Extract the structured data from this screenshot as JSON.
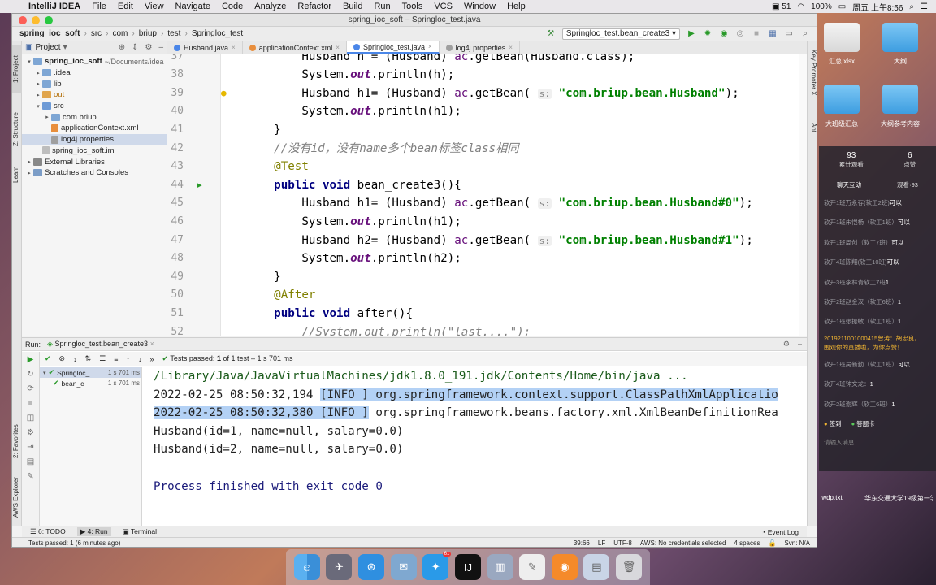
{
  "menubar": {
    "app": "IntelliJ IDEA",
    "items": [
      "File",
      "Edit",
      "View",
      "Navigate",
      "Code",
      "Analyze",
      "Refactor",
      "Build",
      "Run",
      "Tools",
      "VCS",
      "Window",
      "Help"
    ],
    "battery_num": "51",
    "battery": "100%",
    "clock": "周五 上午8:56"
  },
  "window": {
    "title": "spring_ioc_soft – Springloc_test.java"
  },
  "navbar": {
    "crumbs": [
      "spring_ioc_soft",
      "src",
      "com",
      "briup",
      "test",
      "Springloc_test"
    ],
    "run_config": "Springloc_test.bean_create3"
  },
  "left_strip": {
    "project": "1: Project",
    "structure": "Z: Structure",
    "learn": "Learn",
    "favorites": "2: Favorites",
    "aws": "AWS Explorer"
  },
  "right_strip": {
    "promoter": "Key Promoter X",
    "ant": "Ant"
  },
  "project": {
    "header": "Project",
    "tree": [
      {
        "label": "spring_ioc_soft",
        "extra": "~/Documents/idea",
        "indent": 0,
        "arrow": "▾",
        "icon": "fold",
        "bold": true
      },
      {
        "label": ".idea",
        "indent": 1,
        "arrow": "▸",
        "icon": "fold"
      },
      {
        "label": "lib",
        "indent": 1,
        "arrow": "▸",
        "icon": "fold"
      },
      {
        "label": "out",
        "indent": 1,
        "arrow": "▸",
        "icon": "fold o",
        "orange": true
      },
      {
        "label": "src",
        "indent": 1,
        "arrow": "▾",
        "icon": "fold src"
      },
      {
        "label": "com.briup",
        "indent": 2,
        "arrow": "▸",
        "icon": "fold"
      },
      {
        "label": "applicationContext.xml",
        "indent": 2,
        "arrow": "",
        "icon": "fxml"
      },
      {
        "label": "log4j.properties",
        "indent": 2,
        "arrow": "",
        "icon": "fprop",
        "selected": true
      },
      {
        "label": "spring_ioc_soft.iml",
        "indent": 1,
        "arrow": "",
        "icon": "fiml"
      },
      {
        "label": "External Libraries",
        "indent": 0,
        "arrow": "▸",
        "icon": "flib"
      },
      {
        "label": "Scratches and Consoles",
        "indent": 0,
        "arrow": "▸",
        "icon": "fscr"
      }
    ]
  },
  "tabs": [
    {
      "label": "Husband.java",
      "color": "#4a86e8"
    },
    {
      "label": "applicationContext.xml",
      "color": "#e88e3c"
    },
    {
      "label": "Springloc_test.java",
      "color": "#4a86e8",
      "active": true
    },
    {
      "label": "log4j.properties",
      "color": "#9f9f9f"
    }
  ],
  "editor": {
    "lines": [
      {
        "n": "37",
        "segs": [
          [
            "",
            "        Husband h = (Husband) "
          ],
          [
            "m",
            "ac"
          ],
          [
            "",
            ".getBean(Husband.class);"
          ]
        ]
      },
      {
        "n": "38",
        "segs": [
          [
            "",
            "        System."
          ],
          [
            "f",
            "out"
          ],
          [
            "",
            ".println(h);"
          ]
        ]
      },
      {
        "n": "39",
        "segs": [
          [
            "",
            "        Husband h1= (Husband) "
          ],
          [
            "m",
            "ac"
          ],
          [
            "",
            ".getBean( "
          ],
          [
            "hint",
            "s:"
          ],
          [
            "",
            " "
          ],
          [
            "s",
            "\"com.briup.bean.Husband\""
          ],
          [
            "",
            ");"
          ]
        ],
        "bulb": true
      },
      {
        "n": "40",
        "segs": [
          [
            "",
            "        System."
          ],
          [
            "f",
            "out"
          ],
          [
            "",
            ".println(h1);"
          ]
        ]
      },
      {
        "n": "41",
        "segs": [
          [
            "",
            "    }"
          ]
        ]
      },
      {
        "n": "42",
        "segs": [
          [
            "c",
            "    //没有id，没有name多个bean标签class相同"
          ]
        ]
      },
      {
        "n": "43",
        "segs": [
          [
            "a",
            "    @Test"
          ]
        ]
      },
      {
        "n": "44",
        "segs": [
          [
            "k",
            "    public void "
          ],
          [
            "",
            "bean_create3(){"
          ]
        ],
        "runmark": true
      },
      {
        "n": "45",
        "segs": [
          [
            "",
            "        Husband h1= (Husband) "
          ],
          [
            "m",
            "ac"
          ],
          [
            "",
            ".getBean( "
          ],
          [
            "hint",
            "s:"
          ],
          [
            "",
            " "
          ],
          [
            "s",
            "\"com.briup.bean.Husband#0\""
          ],
          [
            "",
            ");"
          ]
        ]
      },
      {
        "n": "46",
        "segs": [
          [
            "",
            "        System."
          ],
          [
            "f",
            "out"
          ],
          [
            "",
            ".println(h1);"
          ]
        ]
      },
      {
        "n": "47",
        "segs": [
          [
            "",
            "        Husband h2= (Husband) "
          ],
          [
            "m",
            "ac"
          ],
          [
            "",
            ".getBean( "
          ],
          [
            "hint",
            "s:"
          ],
          [
            "",
            " "
          ],
          [
            "s",
            "\"com.briup.bean.Husband#1\""
          ],
          [
            "",
            ");"
          ]
        ]
      },
      {
        "n": "48",
        "segs": [
          [
            "",
            "        System."
          ],
          [
            "f",
            "out"
          ],
          [
            "",
            ".println(h2);"
          ]
        ]
      },
      {
        "n": "49",
        "segs": [
          [
            "",
            "    }"
          ]
        ]
      },
      {
        "n": "50",
        "segs": [
          [
            "a",
            "    @After"
          ]
        ]
      },
      {
        "n": "51",
        "segs": [
          [
            "k",
            "    public void "
          ],
          [
            "",
            "after(){"
          ]
        ]
      },
      {
        "n": "52",
        "segs": [
          [
            "c",
            "        //System.out.println(\"last....\");"
          ]
        ]
      }
    ]
  },
  "run": {
    "label": "Run:",
    "config": "Springloc_test.bean_create3",
    "status_prefix": "Tests passed:",
    "passed": "1",
    "status_suffix": "of 1 test – 1 s 701 ms",
    "tree": [
      {
        "label": "Springloc_",
        "time": "1 s 701 ms",
        "indent": 0,
        "sel": true
      },
      {
        "label": "bean_c",
        "time": "1 s 701 ms",
        "indent": 1
      }
    ],
    "console": {
      "path": "/Library/Java/JavaVirtualMachines/jdk1.8.0_191.jdk/Contents/Home/bin/java ...",
      "log1_a": "2022-02-25 08:50:32,194 ",
      "log1_b": "[INFO ] org.springframework.context.support.ClassPathXmlApplicatio",
      "log2_a": "2022-02-25 08:50:32,380 [INFO ]",
      "log2_b": " org.springframework.beans.factory.xml.XmlBeanDefinitionRea",
      "out1": "Husband(id=1, name=null, salary=0.0)",
      "out2": "Husband(id=2, name=null, salary=0.0)",
      "exit": "Process finished with exit code 0"
    }
  },
  "toolwindows": {
    "todo": "6: TODO",
    "run": "4: Run",
    "terminal": "Terminal",
    "event_log": "Event Log"
  },
  "status": {
    "message": "Tests passed: 1 (6 minutes ago)",
    "position": "39:66",
    "lf": "LF",
    "encoding": "UTF-8",
    "aws": "AWS: No credentials selected",
    "indent": "4 spaces",
    "svn": "Svn: N/A"
  },
  "desktop": {
    "icons": [
      "汇总.xlsx",
      "大纲",
      "大班级汇总",
      "大纲参考内容"
    ],
    "bottom_files": [
      "wdp.txt",
      "华东交通大学19级第一学期实...示册.docx"
    ]
  },
  "chat": {
    "viewers": "93",
    "viewers_label": "累计观看",
    "likes": "6",
    "likes_label": "点赞",
    "tab_chat": "聊天互动",
    "tab_watch": "观看·93",
    "messages": [
      {
        "who": "软开1班万永存(软工2班)",
        "text": "可以"
      },
      {
        "who": "软开1班朱恺杨（软工1班）",
        "text": "可以"
      },
      {
        "who": "软开1班周创（软工7班）",
        "text": "可以"
      },
      {
        "who": "软开4班陈翔(软工10班)",
        "text": "可以"
      },
      {
        "who": "软开3班李林青软工7班",
        "text": "1"
      },
      {
        "who": "软开2班赵金汉（软工6班）",
        "text": "1"
      },
      {
        "who": "软开1班张振敏（软工1班）",
        "text": "1"
      },
      {
        "who": "2019211001000415曾涛：胡忠良，",
        "text": "围观你的直播啦，为你点赞！",
        "hot": true
      },
      {
        "who": "软开1班吴新勤（软工1班）",
        "text": "可以"
      },
      {
        "who": "软开4班钟文龙：",
        "text": "1"
      },
      {
        "who": "软开2班谢辉（软工6班）",
        "text": "1"
      }
    ],
    "sign": "签到",
    "card": "答题卡",
    "input_placeholder": "请输入消息"
  },
  "dock": {
    "badge": "61"
  }
}
